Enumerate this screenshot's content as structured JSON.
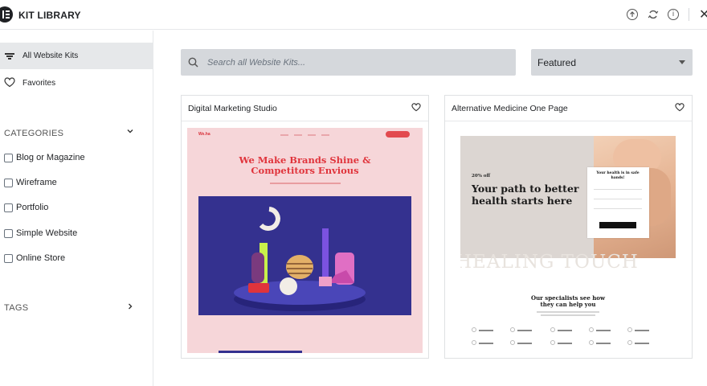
{
  "header": {
    "title": "KIT LIBRARY",
    "info_glyph": "i",
    "close_glyph": "✕"
  },
  "sidebar": {
    "nav": [
      {
        "label": "All Website Kits",
        "icon": "filter-icon",
        "active": true
      },
      {
        "label": "Favorites",
        "icon": "heart-icon",
        "active": false
      }
    ],
    "categories_title": "CATEGORIES",
    "categories": [
      {
        "label": "Blog or Magazine",
        "checked": false
      },
      {
        "label": "Wireframe",
        "checked": false
      },
      {
        "label": "Portfolio",
        "checked": false
      },
      {
        "label": "Simple Website",
        "checked": false
      },
      {
        "label": "Online Store",
        "checked": false
      }
    ],
    "tags_title": "TAGS"
  },
  "search": {
    "placeholder": "Search all Website Kits..."
  },
  "sort": {
    "selected": "Featured"
  },
  "cards": [
    {
      "title": "Digital Marketing Studio",
      "preview": {
        "logo": "We.ha",
        "headline_line1": "We Make Brands Shine &",
        "headline_line2": "Competitors Envious"
      }
    },
    {
      "title": "Alternative Medicine One Page",
      "preview": {
        "offer": "20% off",
        "headline_line1": "Your path to better",
        "headline_line2": "health starts here",
        "form_title_line1": "Your health is in safe",
        "form_title_line2": "hands!",
        "watermark": "HEALING TOUCH",
        "specialists_line1": "Our specialists see how",
        "specialists_line2": "they can help you"
      }
    }
  ],
  "colors": {
    "accent_dark": "#1f2124",
    "panel_gray": "#d5d8dc",
    "active_nav": "#e6e8ea",
    "thumb1_bg": "#f6d6d9",
    "thumb1_headline": "#e0343c",
    "thumb1_scene": "#34318f"
  },
  "corner_glyph": "..."
}
